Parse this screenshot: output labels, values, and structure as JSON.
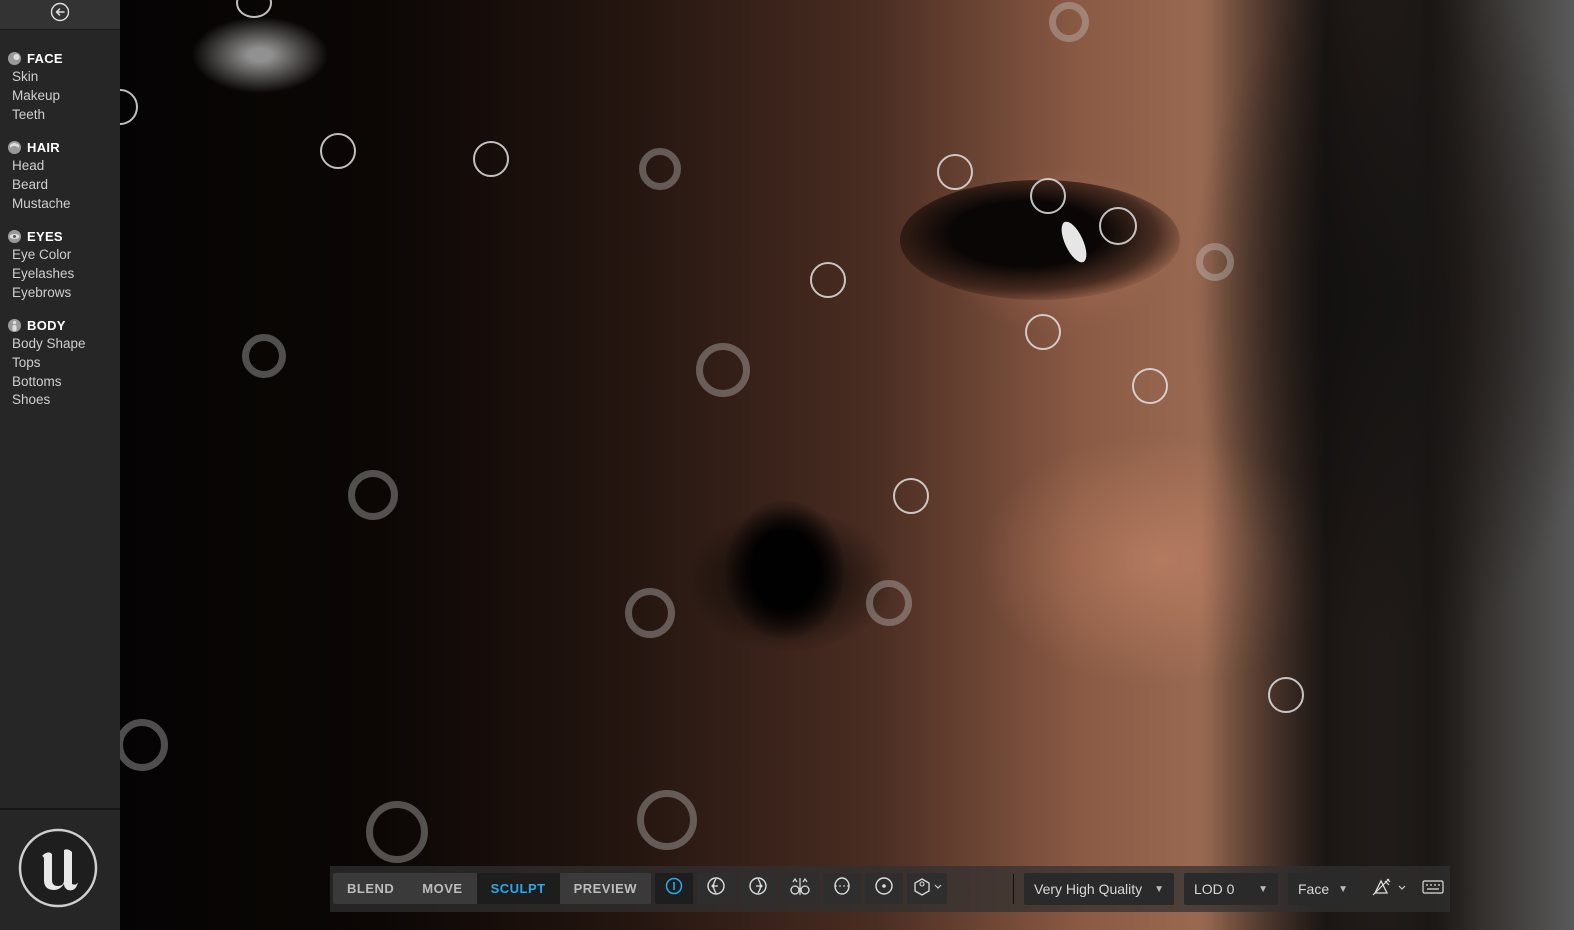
{
  "sidebar": {
    "sections": [
      {
        "title": "FACE",
        "icon": "face-icon",
        "items": [
          "Skin",
          "Makeup",
          "Teeth"
        ]
      },
      {
        "title": "HAIR",
        "icon": "hair-icon",
        "items": [
          "Head",
          "Beard",
          "Mustache"
        ]
      },
      {
        "title": "EYES",
        "icon": "eye-icon",
        "items": [
          "Eye Color",
          "Eyelashes",
          "Eyebrows"
        ]
      },
      {
        "title": "BODY",
        "icon": "body-icon",
        "items": [
          "Body Shape",
          "Tops",
          "Bottoms",
          "Shoes"
        ]
      }
    ]
  },
  "toolbar": {
    "modes": [
      "BLEND",
      "MOVE",
      "SCULPT",
      "PREVIEW"
    ],
    "active_mode": "SCULPT",
    "quality": "Very High Quality",
    "lod": "LOD 0",
    "region": "Face"
  },
  "colors": {
    "accent": "#2aa8e8",
    "sidebar_bg": "#262626",
    "toolbar_bg": "#303030"
  }
}
